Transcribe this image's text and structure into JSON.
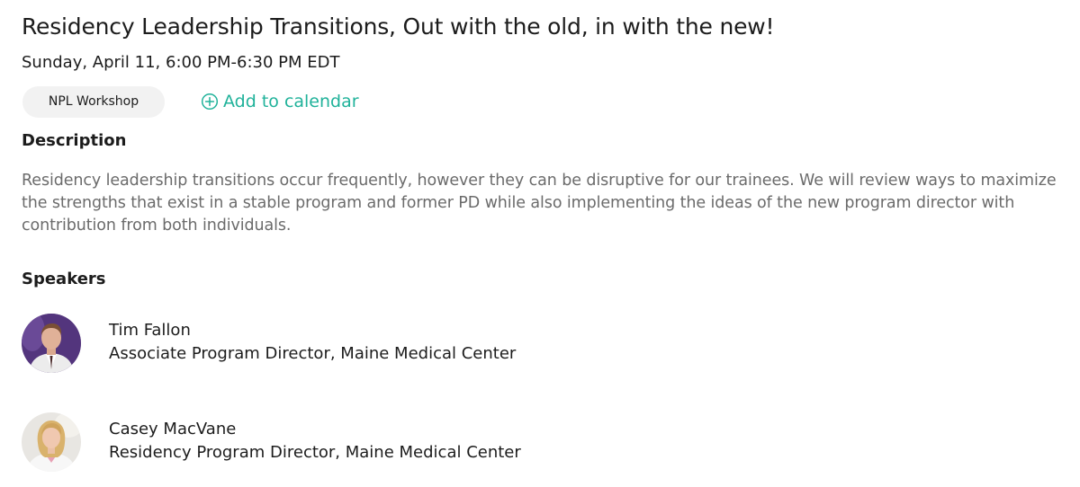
{
  "event": {
    "title": "Residency Leadership Transitions, Out with the old, in with the new!",
    "datetime": "Sunday, April 11, 6:00 PM-6:30 PM EDT",
    "tag": "NPL Workshop",
    "add_to_calendar": "Add to calendar",
    "add_to_calendar_icon": "plus-circle-icon"
  },
  "description": {
    "heading": "Description",
    "text": "Residency leadership transitions occur frequently, however they can be disruptive for our trainees. We will review ways to maximize the strengths that exist in a stable program and former PD while also implementing the ideas of the new program director with contribution from both individuals."
  },
  "speakers": {
    "heading": "Speakers",
    "items": [
      {
        "name": "Tim Fallon",
        "role": "Associate Program Director, Maine Medical Center"
      },
      {
        "name": "Casey MacVane",
        "role": "Residency Program Director, Maine Medical Center"
      }
    ]
  },
  "colors": {
    "accent": "#20b29a",
    "description_text": "#6b6b6b",
    "tag_background": "#f2f2f2"
  }
}
